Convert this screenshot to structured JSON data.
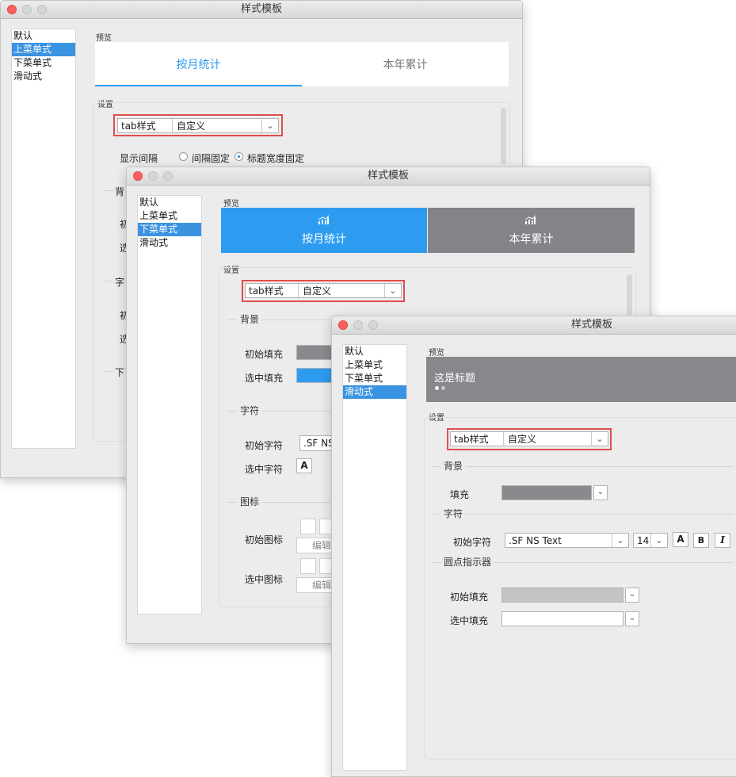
{
  "w1": {
    "title": "样式模板",
    "list": [
      "默认",
      "上菜单式",
      "下菜单式",
      "滑动式"
    ],
    "preview_label": "预览",
    "tab_active": "按月统计",
    "tab_inactive": "本年累计",
    "settings_label": "设置",
    "tab_style_key": "tab样式",
    "tab_style_value": "自定义",
    "spacing_label": "显示间隔",
    "radio_fixed_gap": "间隔固定",
    "radio_fixed_width": "标题宽度固定",
    "partial": [
      "背",
      "初",
      "选",
      "字",
      "初",
      "选",
      "下"
    ]
  },
  "w2": {
    "title": "样式模板",
    "list": [
      "默认",
      "上菜单式",
      "下菜单式",
      "滑动式"
    ],
    "preview_label": "预览",
    "tab_active": "按月统计",
    "tab_inactive": "本年累计",
    "settings_label": "设置",
    "tab_style_key": "tab样式",
    "tab_style_value": "自定义",
    "bg_section": "背景",
    "init_fill": "初始填充",
    "sel_fill": "选中填充",
    "char_section": "字符",
    "init_char": "初始字符",
    "init_char_font": ".SF NS",
    "sel_char": "选中字符",
    "icon_section": "图标",
    "init_icon": "初始图标",
    "sel_icon": "选中图标",
    "edit": "编辑",
    "colors": {
      "active_tab": "#2d9cf0",
      "inactive_tab": "#838487",
      "init_fill": "#898a8d",
      "sel_fill": "#2d9cf0"
    }
  },
  "w3": {
    "title": "样式模板",
    "list": [
      "默认",
      "上菜单式",
      "下菜单式",
      "滑动式"
    ],
    "preview_label": "预览",
    "preview_title": "这是标题",
    "settings_label": "设置",
    "tab_style_key": "tab样式",
    "tab_style_value": "自定义",
    "bg_section": "背景",
    "fill_label": "填充",
    "char_section": "字符",
    "init_char": "初始字符",
    "font_value": ".SF NS Text",
    "font_size": "14",
    "dot_section": "圆点指示器",
    "init_fill": "初始填充",
    "sel_fill": "选中填充",
    "colors": {
      "preview_bg": "#87888b",
      "fill": "#898a8d",
      "init_fill": "#c4c4c4",
      "sel_fill": "#ffffff"
    }
  },
  "icons": {
    "chart": "bar-chart-icon",
    "chevron": "chevron-down-icon",
    "bold": "B",
    "italic": "I",
    "font_color": "A"
  }
}
